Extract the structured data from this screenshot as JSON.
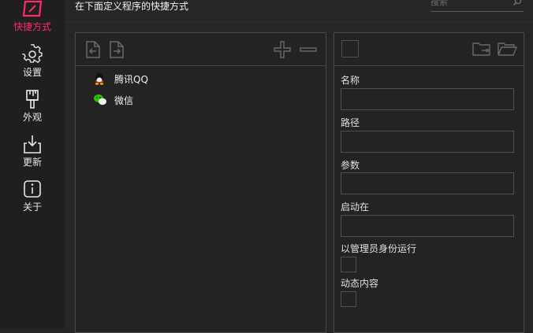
{
  "sidebar": {
    "items": [
      {
        "label": "快捷方式",
        "icon": "shortcut-icon",
        "active": true
      },
      {
        "label": "设置",
        "icon": "gear-icon"
      },
      {
        "label": "外观",
        "icon": "brush-icon"
      },
      {
        "label": "更新",
        "icon": "download-icon"
      },
      {
        "label": "关于",
        "icon": "info-icon"
      }
    ],
    "accent_color": "#ff2a68"
  },
  "header": {
    "title": "在下面定义程序的快捷方式",
    "search_placeholder": "搜索"
  },
  "shortcut_list": {
    "toolbar": [
      "import-icon",
      "export-icon",
      "add-icon",
      "remove-icon"
    ],
    "items": [
      {
        "label": "腾讯QQ",
        "icon": "qq-icon"
      },
      {
        "label": "微信",
        "icon": "wechat-icon"
      }
    ]
  },
  "detail": {
    "toolbar": [
      "icon-preview",
      "folder-link-icon",
      "folder-open-icon"
    ],
    "fields": {
      "name_label": "名称",
      "path_label": "路径",
      "args_label": "参数",
      "start_in_label": "启动在",
      "run_as_admin_label": "以管理员身份运行",
      "dynamic_content_label": "动态内容"
    }
  }
}
